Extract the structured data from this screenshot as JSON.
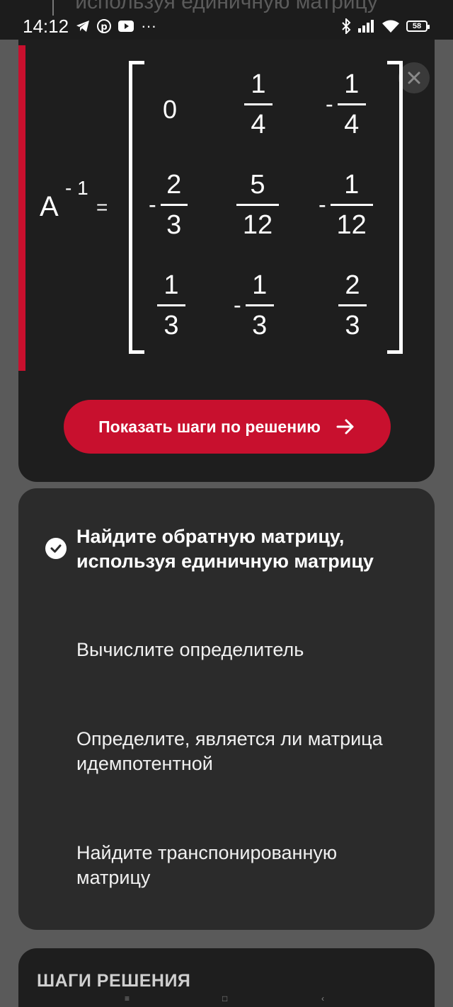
{
  "status_bar": {
    "time": "14:12",
    "ghost_header": "используя единичную матрицу",
    "battery": "58",
    "dots": "···"
  },
  "result": {
    "matrix_name": "A",
    "exponent": "- 1",
    "equals": "=",
    "matrix": [
      [
        {
          "sign": "",
          "whole": "0"
        },
        {
          "sign": "",
          "num": "1",
          "den": "4"
        },
        {
          "sign": "-",
          "num": "1",
          "den": "4"
        }
      ],
      [
        {
          "sign": "-",
          "num": "2",
          "den": "3"
        },
        {
          "sign": "",
          "num": "5",
          "den": "12"
        },
        {
          "sign": "-",
          "num": "1",
          "den": "12"
        }
      ],
      [
        {
          "sign": "",
          "num": "1",
          "den": "3"
        },
        {
          "sign": "-",
          "num": "1",
          "den": "3"
        },
        {
          "sign": "",
          "num": "2",
          "den": "3"
        }
      ]
    ],
    "show_steps_label": "Показать шаги по решению"
  },
  "options": [
    {
      "label": "Найдите обратную матрицу, используя единичную матрицу",
      "active": true
    },
    {
      "label": "Вычислите определитель",
      "active": false
    },
    {
      "label": "Определите, является ли матрица идемпотентной",
      "active": false
    },
    {
      "label": "Найдите транспонированную матрицу",
      "active": false
    }
  ],
  "steps_section": {
    "title": "ШАГИ РЕШЕНИЯ"
  },
  "colors": {
    "accent": "#c8102e",
    "card_dark": "#1e1e1e",
    "card_gray": "#2b2b2b"
  }
}
